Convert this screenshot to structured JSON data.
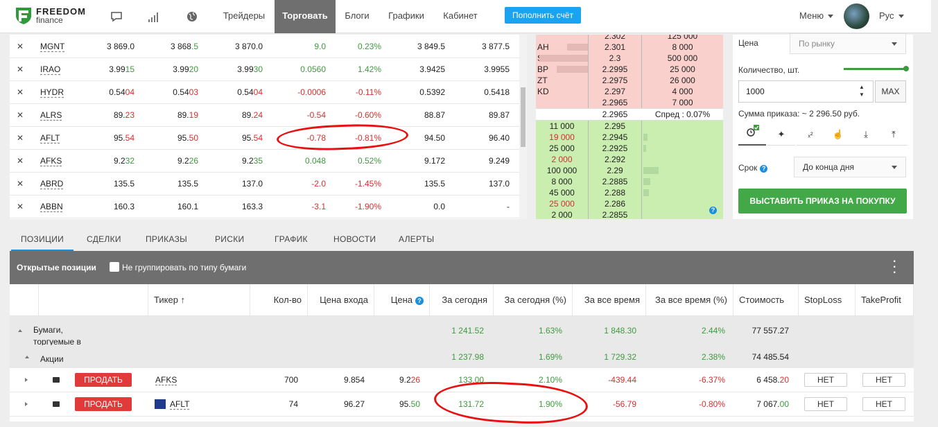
{
  "brand": {
    "name_line1": "FREEDOM",
    "name_line2": "finance"
  },
  "topnav": {
    "items": [
      "Трейдеры",
      "Торговать",
      "Блоги",
      "Графики",
      "Кабинет"
    ],
    "deposit_label": "Пополнить счёт",
    "menu_label": "Меню",
    "lang_label": "Рус"
  },
  "watchlist": {
    "rows": [
      {
        "ticker": "MGNT",
        "bid": "3 869.0",
        "last": "3 868.5",
        "ask": "3 870.0",
        "chg": "9.0",
        "chg_pct": "0.23%",
        "low": "3 849.5",
        "high": "3 877.5",
        "dir": "up"
      },
      {
        "ticker": "IRAO",
        "bid": "3.9915",
        "last": "3.9920",
        "ask": "3.9930",
        "chg": "0.0560",
        "chg_pct": "1.42%",
        "low": "3.9425",
        "high": "3.9955",
        "dir": "up"
      },
      {
        "ticker": "HYDR",
        "bid": "0.5404",
        "last": "0.5403",
        "ask": "0.5404",
        "chg": "-0.0006",
        "chg_pct": "-0.11%",
        "low": "0.5392",
        "high": "0.5418",
        "dir": "down"
      },
      {
        "ticker": "ALRS",
        "bid": "89.23",
        "last": "89.19",
        "ask": "89.24",
        "chg": "-0.54",
        "chg_pct": "-0.60%",
        "low": "88.87",
        "high": "89.87",
        "dir": "down"
      },
      {
        "ticker": "AFLT",
        "bid": "95.54",
        "last": "95.50",
        "ask": "95.54",
        "chg": "-0.78",
        "chg_pct": "-0.81%",
        "low": "94.50",
        "high": "96.40",
        "dir": "down"
      },
      {
        "ticker": "AFKS",
        "bid": "9.232",
        "last": "9.226",
        "ask": "9.235",
        "chg": "0.048",
        "chg_pct": "0.52%",
        "low": "9.172",
        "high": "9.249",
        "dir": "up"
      },
      {
        "ticker": "ABRD",
        "bid": "135.5",
        "last": "135.5",
        "ask": "137.0",
        "chg": "-2.0",
        "chg_pct": "-1.45%",
        "low": "135.5",
        "high": "137.0",
        "dir": "down"
      },
      {
        "ticker": "ABBN",
        "bid": "160.3",
        "last": "160.1",
        "ask": "163.3",
        "chg": "-3.1",
        "chg_pct": "-1.90%",
        "low": "0.0",
        "high": "-",
        "dir": "down"
      }
    ]
  },
  "orderbook": {
    "asks": [
      {
        "tag": "",
        "price": "2.302",
        "volume": "125 000"
      },
      {
        "tag": "AH",
        "price": "2.301",
        "volume": "8 000"
      },
      {
        "tag": "SD",
        "price": "2.3",
        "volume": "500 000"
      },
      {
        "tag": "BP",
        "price": "2.2995",
        "volume": "25 000"
      },
      {
        "tag": "ZT",
        "price": "2.2975",
        "volume": "26 000"
      },
      {
        "tag": "KD",
        "price": "2.297",
        "volume": "4 000"
      },
      {
        "tag": "",
        "price": "2.2965",
        "volume": "7 000"
      }
    ],
    "mid_price": "2.2965",
    "spread_label": "Спред : 0.07%",
    "bids": [
      {
        "volume": "11 000",
        "price": "2.295"
      },
      {
        "volume": "19 000",
        "price": "2.2945"
      },
      {
        "volume": "25 000",
        "price": "2.2925"
      },
      {
        "volume": "2 000",
        "price": "2.292"
      },
      {
        "volume": "100 000",
        "price": "2.29"
      },
      {
        "volume": "8 000",
        "price": "2.2885"
      },
      {
        "volume": "45 000",
        "price": "2.288"
      },
      {
        "volume": "25 000",
        "price": "2.286"
      },
      {
        "volume": "2 000",
        "price": "2.2855"
      }
    ],
    "help_glyph": "?"
  },
  "order_panel": {
    "price_label": "Цена",
    "price_value": "По рынку",
    "qty_label": "Количество, шт.",
    "qty_value": "1000",
    "max_label": "MAX",
    "sum_label": "Сумма приказа:  ~ 2 296.50 руб.",
    "term_label": "Срок",
    "term_value": "До конца дня",
    "buy_label": "ВЫСТАВИТЬ ПРИКАЗ НА ПОКУПКУ",
    "order_type_tabs": [
      "time",
      "stop",
      "x2",
      "hand",
      "down",
      "up"
    ]
  },
  "bottom_tabs": [
    "ПОЗИЦИИ",
    "СДЕЛКИ",
    "ПРИКАЗЫ",
    "РИСКИ",
    "ГРАФИК",
    "НОВОСТИ",
    "АЛЕРТЫ"
  ],
  "positions": {
    "title": "Открытые позиции",
    "group_label": "Не группировать по типу бумаги",
    "columns": [
      "Тикер",
      "Кол-во",
      "Цена входа",
      "Цена",
      "За сегодня",
      "За сегодня (%)",
      "За все время",
      "За все время (%)",
      "Стоимость",
      "StopLoss",
      "TakeProfit"
    ],
    "group1": {
      "label": "Бумаги, торгуемые в рублях ₽",
      "today": "1 241.52",
      "today_pct": "1.63%",
      "all": "1 848.30",
      "all_pct": "2.44%",
      "cost": "77 557.27"
    },
    "group2": {
      "label": "Акции",
      "today": "1 237.98",
      "today_pct": "1.69%",
      "all": "1 729.32",
      "all_pct": "2.38%",
      "cost": "74 485.54"
    },
    "rows": [
      {
        "sell": "ПРОДАТЬ",
        "ticker": "AFKS",
        "qty": "700",
        "entry": "9.854",
        "price": "9.226",
        "today": "133.00",
        "today_pct": "2.10%",
        "all": "-439.44",
        "all_pct": "-6.37%",
        "cost": "6 458.20",
        "sl": "НЕТ",
        "tp": "НЕТ"
      },
      {
        "sell": "ПРОДАТЬ",
        "ticker": "AFLT",
        "qty": "74",
        "entry": "96.27",
        "price": "95.50",
        "today": "131.72",
        "today_pct": "1.90%",
        "all": "-56.79",
        "all_pct": "-0.80%",
        "cost": "7 067.00",
        "sl": "НЕТ",
        "tp": "НЕТ"
      }
    ]
  },
  "colors": {
    "up": "#3e9a3e",
    "down": "#d43030",
    "accent": "#1aa3f0",
    "buy": "#43a847",
    "sell": "#e03a3a",
    "annotation": "#e81010"
  }
}
